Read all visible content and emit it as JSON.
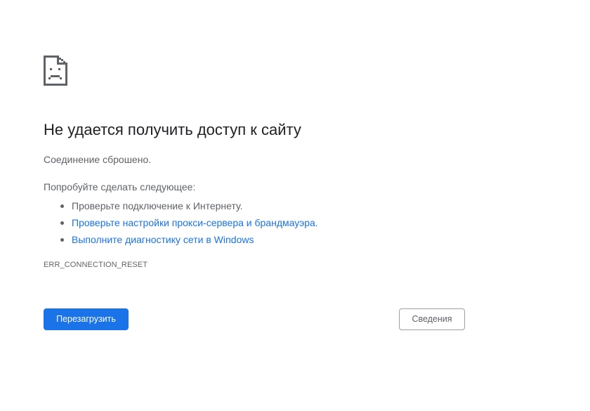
{
  "error_page": {
    "icon": "sad-page-icon",
    "title": "Не удается получить доступ к сайту",
    "summary": "Соединение сброшено.",
    "suggestions_heading": "Попробуйте сделать следующее:",
    "suggestions": [
      {
        "text": "Проверьте подключение к Интернету.",
        "is_link": false
      },
      {
        "text": "Проверьте настройки прокси-сервера и брандмауэра.",
        "is_link": true
      },
      {
        "text": "Выполните диагностику сети в Windows",
        "is_link": true
      }
    ],
    "error_code": "ERR_CONNECTION_RESET",
    "reload_button_label": "Перезагрузить",
    "details_button_label": "Сведения"
  },
  "colors": {
    "primary": "#1a73e8",
    "title_text": "#202124",
    "body_text": "#5f6368",
    "link": "#1a73e8",
    "button_border": "#9aa0a6"
  }
}
